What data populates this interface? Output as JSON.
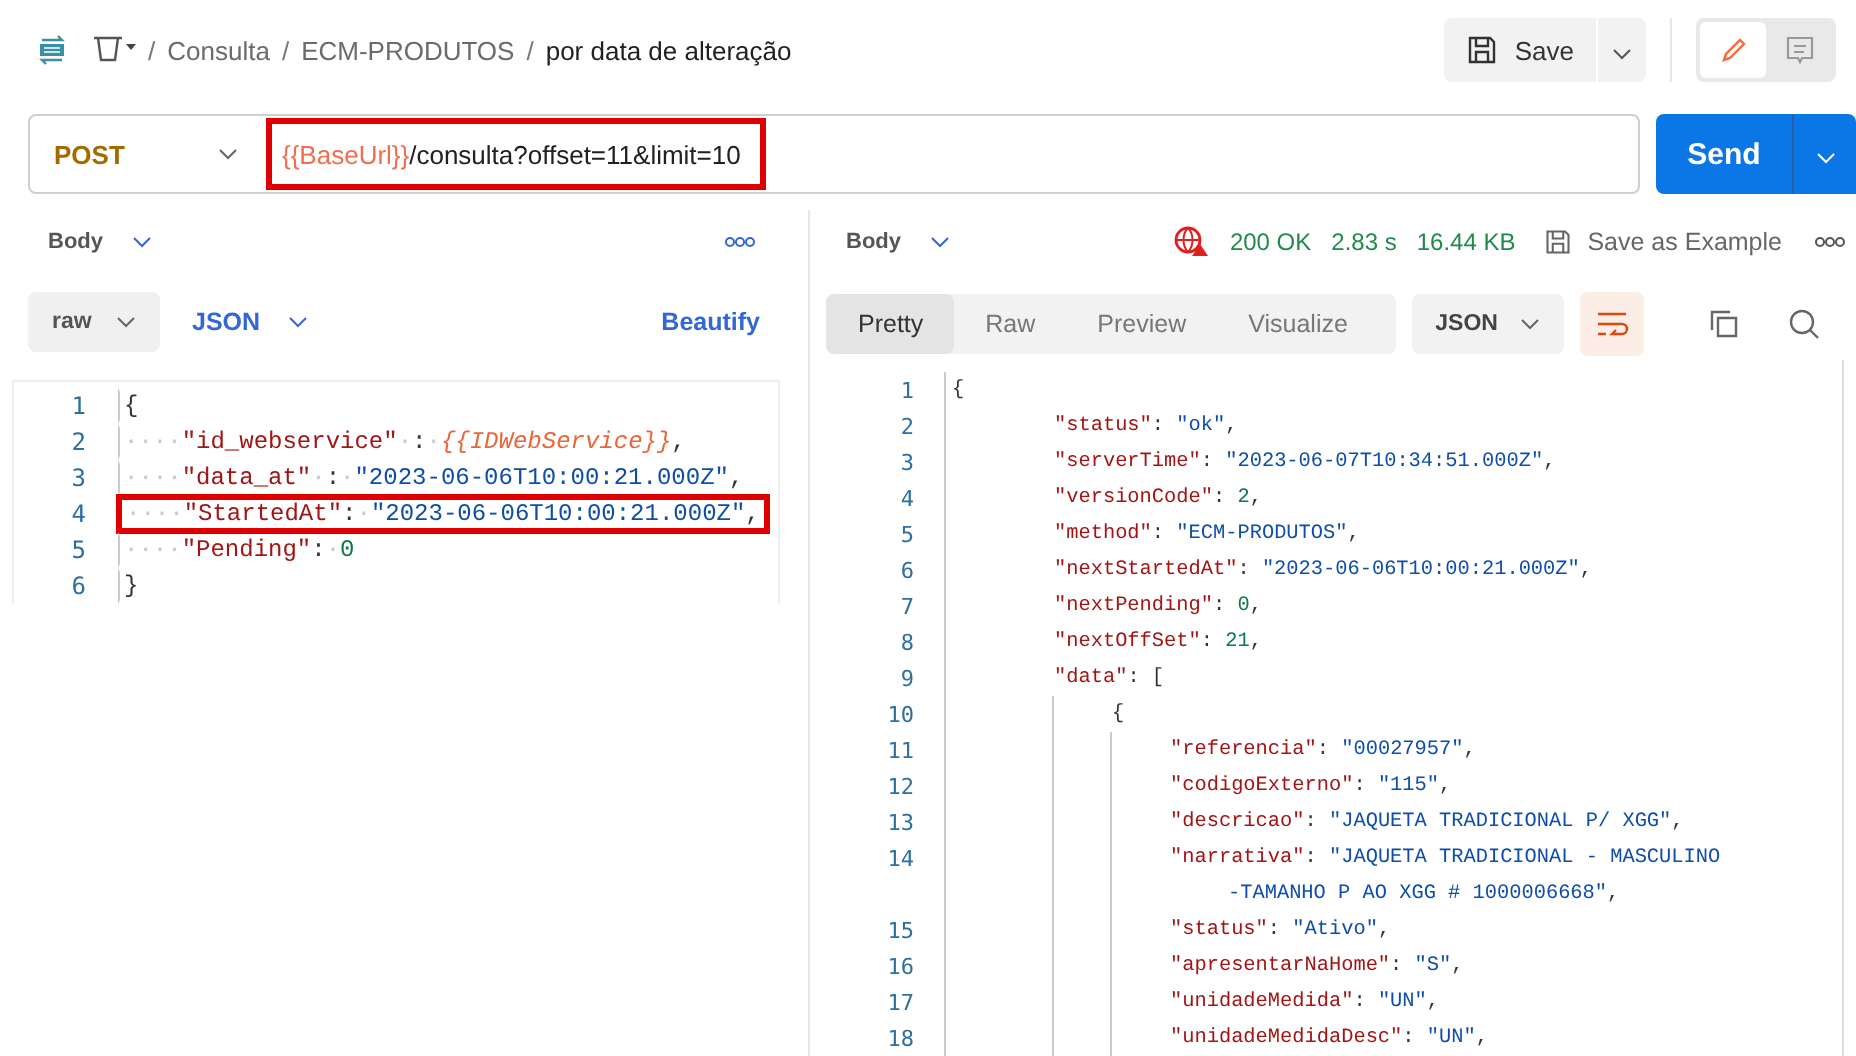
{
  "breadcrumb": {
    "items": [
      {
        "separator": "/",
        "text": "Consulta"
      },
      {
        "separator": "/",
        "text": "ECM-PRODUTOS"
      }
    ],
    "current_separator": "/",
    "current": "por data de alteração"
  },
  "header_actions": {
    "save": "Save",
    "modes": [
      {
        "kind": "edit",
        "selected": true
      },
      {
        "kind": "comment",
        "selected": false
      }
    ]
  },
  "request": {
    "method": "POST",
    "url_variable": "{{BaseUrl}}",
    "url_path": "/consulta?offset=11&limit=10",
    "highlighted": true,
    "send": "Send"
  },
  "request_body": {
    "tab": "Body",
    "mode": "raw",
    "language": "JSON",
    "beautify": "Beautify",
    "lines": [
      {
        "n": "1",
        "highlighted": false,
        "tokens": [
          {
            "kind": "punct",
            "text": "{"
          }
        ]
      },
      {
        "n": "2",
        "highlighted": false,
        "tokens": [
          {
            "kind": "ws",
            "text": "····"
          },
          {
            "kind": "key",
            "text": "\"id_webservice\""
          },
          {
            "kind": "ws",
            "text": "·"
          },
          {
            "kind": "punct",
            "text": ":"
          },
          {
            "kind": "ws",
            "text": "·"
          },
          {
            "kind": "var",
            "text": "{{IDWebService}}"
          },
          {
            "kind": "punct",
            "text": ","
          }
        ]
      },
      {
        "n": "3",
        "highlighted": false,
        "tokens": [
          {
            "kind": "ws",
            "text": "····"
          },
          {
            "kind": "key",
            "text": "\"data_at\""
          },
          {
            "kind": "ws",
            "text": "·"
          },
          {
            "kind": "punct",
            "text": ":"
          },
          {
            "kind": "ws",
            "text": "·"
          },
          {
            "kind": "str",
            "text": "\"2023-06-06T10:00:21.000Z\""
          },
          {
            "kind": "punct",
            "text": ","
          }
        ]
      },
      {
        "n": "4",
        "highlighted": true,
        "tokens": [
          {
            "kind": "ws",
            "text": "····"
          },
          {
            "kind": "key",
            "text": "\"StartedAt\""
          },
          {
            "kind": "punct",
            "text": ":"
          },
          {
            "kind": "ws",
            "text": "·"
          },
          {
            "kind": "str",
            "text": "\"2023-06-06T10:00:21.000Z\""
          },
          {
            "kind": "punct",
            "text": ","
          }
        ]
      },
      {
        "n": "5",
        "highlighted": false,
        "tokens": [
          {
            "kind": "ws",
            "text": "····"
          },
          {
            "kind": "key",
            "text": "\"Pending\""
          },
          {
            "kind": "punct",
            "text": ":"
          },
          {
            "kind": "ws",
            "text": "·"
          },
          {
            "kind": "num",
            "text": "0"
          }
        ]
      },
      {
        "n": "6",
        "highlighted": false,
        "tokens": [
          {
            "kind": "punct",
            "text": "}"
          }
        ]
      }
    ]
  },
  "response": {
    "tab": "Body",
    "status": "200 OK",
    "time": "2.83 s",
    "size": "16.44 KB",
    "save_example": "Save as Example",
    "views": [
      {
        "label": "Pretty",
        "selected": true
      },
      {
        "label": "Raw",
        "selected": false
      },
      {
        "label": "Preview",
        "selected": false
      },
      {
        "label": "Visualize",
        "selected": false
      }
    ],
    "language": "JSON",
    "wrap_enabled": true,
    "lines": [
      {
        "n": "1",
        "tokens": [
          {
            "kind": "punct",
            "text": "{"
          }
        ],
        "children": [
          {
            "n": "2",
            "tokens": [
              {
                "kind": "key",
                "text": "\"status\""
              },
              {
                "kind": "punct",
                "text": ": "
              },
              {
                "kind": "str",
                "text": "\"ok\""
              },
              {
                "kind": "punct",
                "text": ","
              }
            ]
          },
          {
            "n": "3",
            "tokens": [
              {
                "kind": "key",
                "text": "\"serverTime\""
              },
              {
                "kind": "punct",
                "text": ": "
              },
              {
                "kind": "str",
                "text": "\"2023-06-07T10:34:51.000Z\""
              },
              {
                "kind": "punct",
                "text": ","
              }
            ]
          },
          {
            "n": "4",
            "tokens": [
              {
                "kind": "key",
                "text": "\"versionCode\""
              },
              {
                "kind": "punct",
                "text": ": "
              },
              {
                "kind": "num",
                "text": "2"
              },
              {
                "kind": "punct",
                "text": ","
              }
            ]
          },
          {
            "n": "5",
            "tokens": [
              {
                "kind": "key",
                "text": "\"method\""
              },
              {
                "kind": "punct",
                "text": ": "
              },
              {
                "kind": "str",
                "text": "\"ECM-PRODUTOS\""
              },
              {
                "kind": "punct",
                "text": ","
              }
            ]
          },
          {
            "n": "6",
            "tokens": [
              {
                "kind": "key",
                "text": "\"nextStartedAt\""
              },
              {
                "kind": "punct",
                "text": ": "
              },
              {
                "kind": "str",
                "text": "\"2023-06-06T10:00:21.000Z\""
              },
              {
                "kind": "punct",
                "text": ","
              }
            ]
          },
          {
            "n": "7",
            "tokens": [
              {
                "kind": "key",
                "text": "\"nextPending\""
              },
              {
                "kind": "punct",
                "text": ": "
              },
              {
                "kind": "num",
                "text": "0"
              },
              {
                "kind": "punct",
                "text": ","
              }
            ]
          },
          {
            "n": "8",
            "tokens": [
              {
                "kind": "key",
                "text": "\"nextOffSet\""
              },
              {
                "kind": "punct",
                "text": ": "
              },
              {
                "kind": "num",
                "text": "21"
              },
              {
                "kind": "punct",
                "text": ","
              }
            ]
          },
          {
            "n": "9",
            "tokens": [
              {
                "kind": "key",
                "text": "\"data\""
              },
              {
                "kind": "punct",
                "text": ": ["
              }
            ],
            "children": [
              {
                "n": "10",
                "tokens": [
                  {
                    "kind": "punct",
                    "text": "{"
                  }
                ],
                "children": [
                  {
                    "n": "11",
                    "tokens": [
                      {
                        "kind": "key",
                        "text": "\"referencia\""
                      },
                      {
                        "kind": "punct",
                        "text": ": "
                      },
                      {
                        "kind": "str",
                        "text": "\"00027957\""
                      },
                      {
                        "kind": "punct",
                        "text": ","
                      }
                    ]
                  },
                  {
                    "n": "12",
                    "tokens": [
                      {
                        "kind": "key",
                        "text": "\"codigoExterno\""
                      },
                      {
                        "kind": "punct",
                        "text": ": "
                      },
                      {
                        "kind": "str",
                        "text": "\"115\""
                      },
                      {
                        "kind": "punct",
                        "text": ","
                      }
                    ]
                  },
                  {
                    "n": "13",
                    "tokens": [
                      {
                        "kind": "key",
                        "text": "\"descricao\""
                      },
                      {
                        "kind": "punct",
                        "text": ": "
                      },
                      {
                        "kind": "str",
                        "text": "\"JAQUETA TRADICIONAL P/ XGG\""
                      },
                      {
                        "kind": "punct",
                        "text": ","
                      }
                    ]
                  },
                  {
                    "n": "14",
                    "tokens": [
                      {
                        "kind": "key",
                        "text": "\"narrativa\""
                      },
                      {
                        "kind": "punct",
                        "text": ": "
                      },
                      {
                        "kind": "str",
                        "text": "\"JAQUETA TRADICIONAL - MASCULINO"
                      }
                    ],
                    "wrap": [
                      {
                        "kind": "str",
                        "text": "-TAMANHO P AO XGG # 1000006668\""
                      },
                      {
                        "kind": "punct",
                        "text": ","
                      }
                    ]
                  },
                  {
                    "n": "15",
                    "tokens": [
                      {
                        "kind": "key",
                        "text": "\"status\""
                      },
                      {
                        "kind": "punct",
                        "text": ": "
                      },
                      {
                        "kind": "str",
                        "text": "\"Ativo\""
                      },
                      {
                        "kind": "punct",
                        "text": ","
                      }
                    ]
                  },
                  {
                    "n": "16",
                    "tokens": [
                      {
                        "kind": "key",
                        "text": "\"apresentarNaHome\""
                      },
                      {
                        "kind": "punct",
                        "text": ": "
                      },
                      {
                        "kind": "str",
                        "text": "\"S\""
                      },
                      {
                        "kind": "punct",
                        "text": ","
                      }
                    ]
                  },
                  {
                    "n": "17",
                    "tokens": [
                      {
                        "kind": "key",
                        "text": "\"unidadeMedida\""
                      },
                      {
                        "kind": "punct",
                        "text": ": "
                      },
                      {
                        "kind": "str",
                        "text": "\"UN\""
                      },
                      {
                        "kind": "punct",
                        "text": ","
                      }
                    ]
                  },
                  {
                    "n": "18",
                    "tokens": [
                      {
                        "kind": "key",
                        "text": "\"unidadeMedidaDesc\""
                      },
                      {
                        "kind": "punct",
                        "text": ": "
                      },
                      {
                        "kind": "str",
                        "text": "\"UN\""
                      },
                      {
                        "kind": "punct",
                        "text": ","
                      }
                    ]
                  }
                ]
              }
            ]
          }
        ]
      }
    ]
  }
}
